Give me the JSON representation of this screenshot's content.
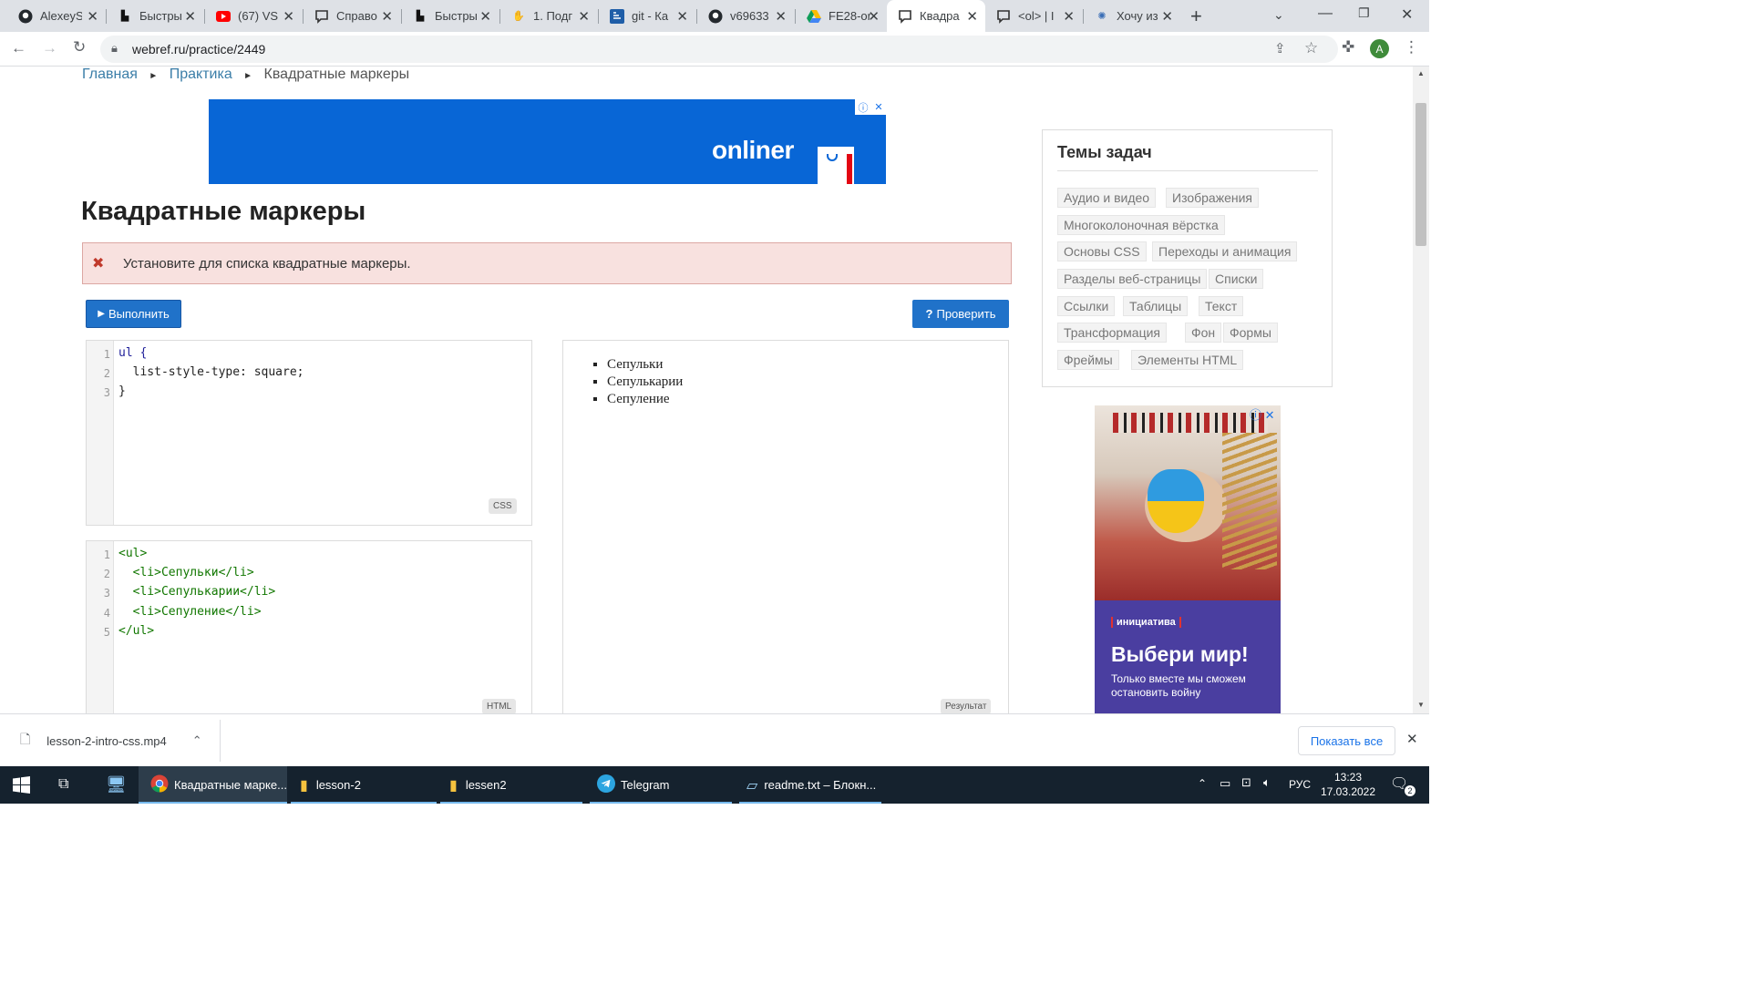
{
  "browser": {
    "tabs": [
      {
        "title": "AlexeyS",
        "icon": "github-icon"
      },
      {
        "title": "Быстры",
        "icon": "webref-icon"
      },
      {
        "title": "(67) VS",
        "icon": "youtube-icon"
      },
      {
        "title": "Справо",
        "icon": "chat-icon"
      },
      {
        "title": "Быстры",
        "icon": "webref-icon"
      },
      {
        "title": "1. Подг",
        "icon": "hand-icon"
      },
      {
        "title": "git - Ка",
        "icon": "stackoverflow-icon"
      },
      {
        "title": "v69633",
        "icon": "github-icon"
      },
      {
        "title": "FE28-or",
        "icon": "drive-icon"
      },
      {
        "title": "Квадра",
        "icon": "chat-icon",
        "active": true
      },
      {
        "title": "<ol> | I",
        "icon": "chat-icon"
      },
      {
        "title": "Хочу из",
        "icon": "gear-icon"
      }
    ],
    "url": "webref.ru/practice/2449",
    "profile_initial": "A"
  },
  "breadcrumb": {
    "home": "Главная",
    "practice": "Практика",
    "current": "Квадратные маркеры"
  },
  "ad_top": {
    "brand": "onliner"
  },
  "page": {
    "title": "Квадратные маркеры",
    "task": "Установите для списка квадратные маркеры.",
    "run_label": "Выполнить",
    "check_label": "Проверить"
  },
  "css_editor": {
    "label": "CSS",
    "line_numbers": [
      "1",
      "2",
      "3"
    ],
    "lines": [
      "ul {",
      "  list-style-type: square;",
      "}"
    ]
  },
  "html_editor": {
    "label": "HTML",
    "line_numbers": [
      "1",
      "2",
      "3",
      "4",
      "5"
    ],
    "lines": [
      "<ul>",
      "  <li>Сепульки</li>",
      "  <li>Сепулькарии</li>",
      "  <li>Сепуление</li>",
      "</ul>"
    ]
  },
  "result": {
    "label": "Результат",
    "items": [
      "Сепульки",
      "Сепулькарии",
      "Сепуление"
    ]
  },
  "topics": {
    "title": "Темы задач",
    "items": [
      "Аудио и видео",
      "Изображения",
      "Многоколоночная вёрстка",
      "Основы CSS",
      "Переходы и анимация",
      "Разделы веб-страницы",
      "Списки",
      "Ссылки",
      "Таблицы",
      "Текст",
      "Трансформация",
      "Фон",
      "Формы",
      "Фреймы",
      "Элементы HTML"
    ]
  },
  "ad_side": {
    "brand": "инициатива",
    "headline": "Выбери мир!",
    "subtext": "Только вместе мы сможем остановить войну"
  },
  "downloads": {
    "file": "lesson-2-intro-css.mp4",
    "show_all": "Показать все"
  },
  "taskbar": {
    "apps": [
      "Квадратные марке...",
      "lesson-2",
      "lessen2",
      "Telegram",
      "readme.txt – Блокн..."
    ],
    "lang": "РУС",
    "time": "13:23",
    "date": "17.03.2022",
    "notifications": "2"
  },
  "colors": {
    "accent": "#2072c9",
    "link": "#3b7ea8",
    "error_bg": "#f8e1df",
    "taskbar": "#15222e"
  }
}
